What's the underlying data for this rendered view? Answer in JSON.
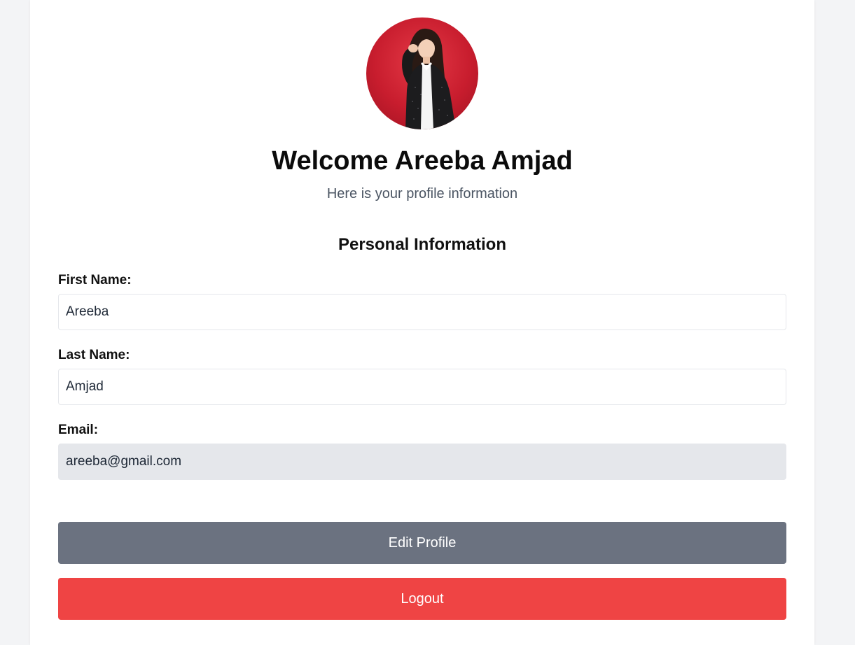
{
  "profile": {
    "welcome_title": "Welcome Areeba Amjad",
    "subtitle": "Here is your profile information",
    "section_title": "Personal Information"
  },
  "fields": {
    "first_name": {
      "label": "First Name:",
      "value": "Areeba"
    },
    "last_name": {
      "label": "Last Name:",
      "value": "Amjad"
    },
    "email": {
      "label": "Email:",
      "value": "areeba@gmail.com"
    }
  },
  "actions": {
    "edit_label": "Edit Profile",
    "logout_label": "Logout"
  },
  "colors": {
    "page_background": "#f3f4f6",
    "card_background": "#ffffff",
    "edit_button": "#6b7280",
    "logout_button": "#ef4444",
    "readonly_field": "#e5e7eb",
    "avatar_background": "#d0202f"
  }
}
